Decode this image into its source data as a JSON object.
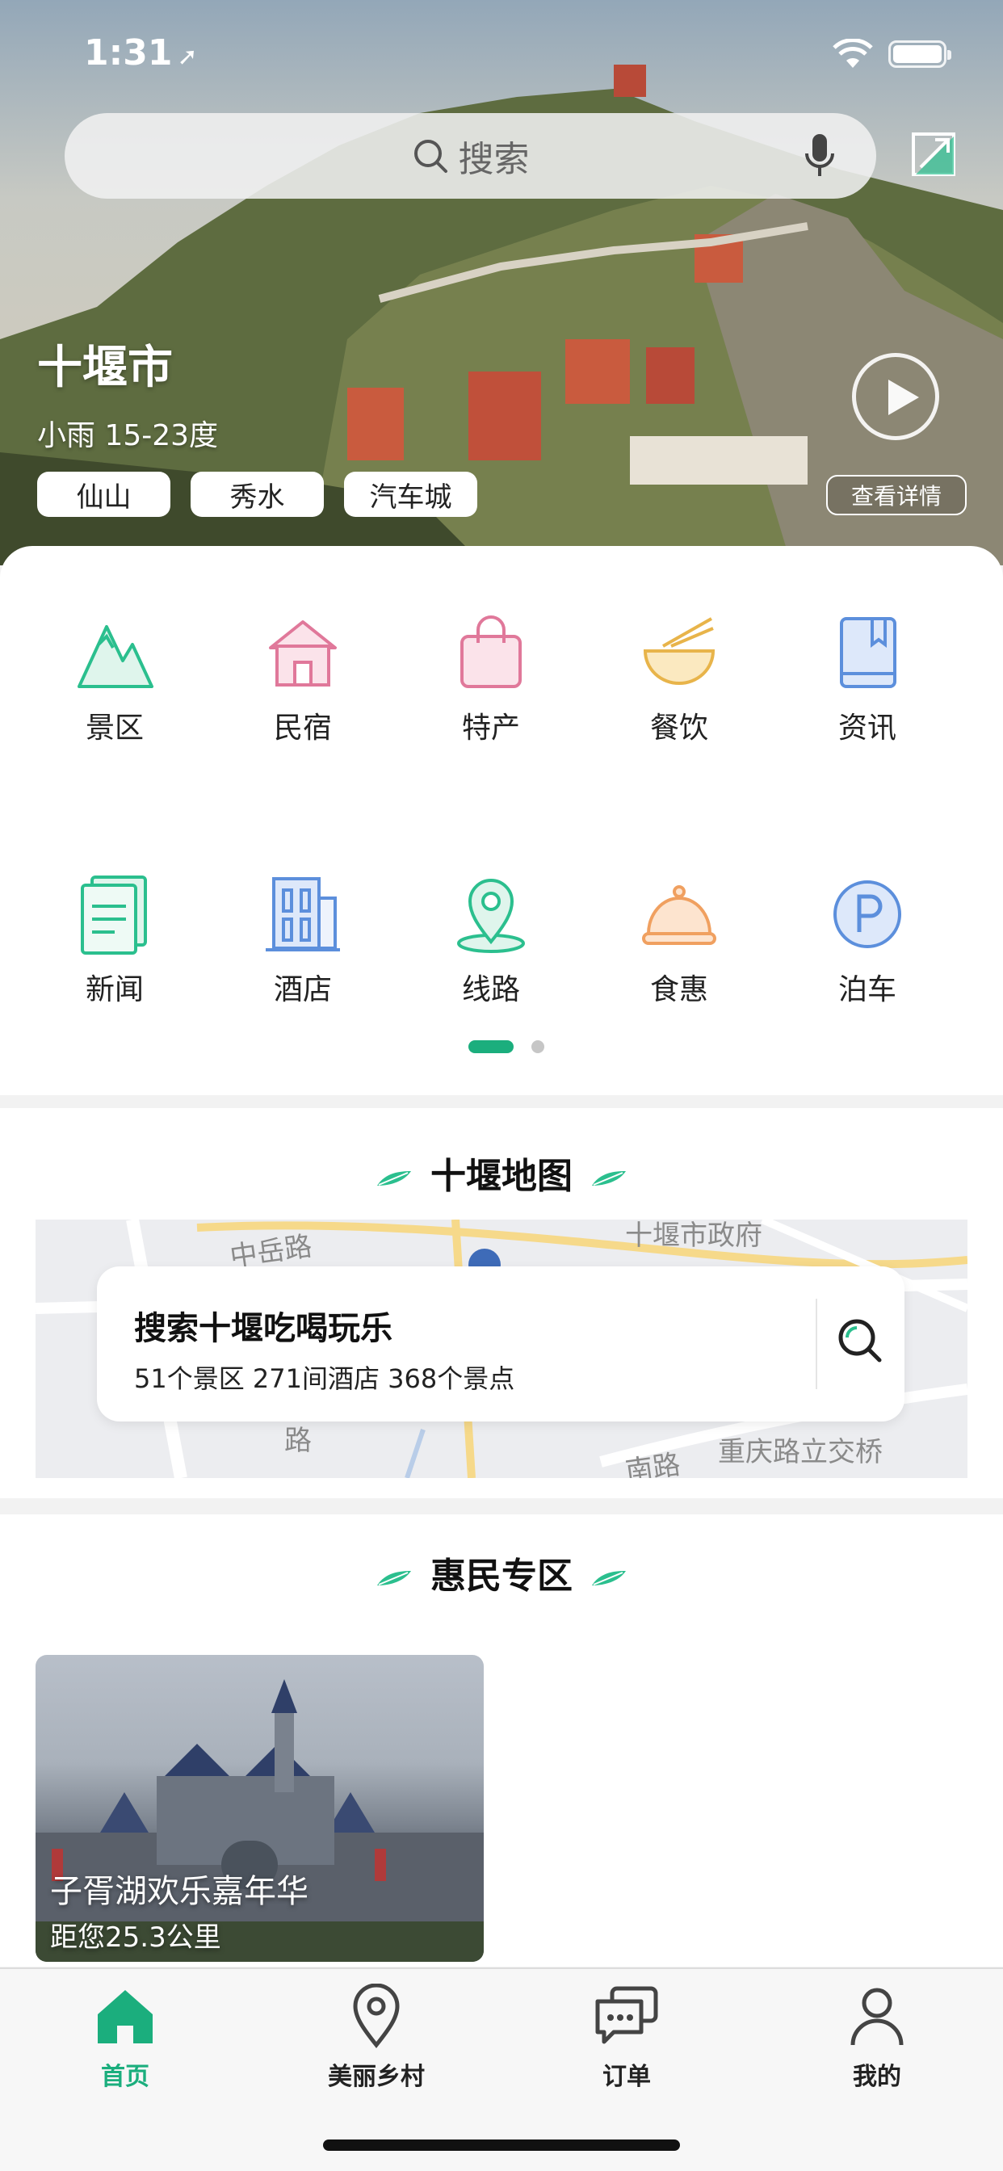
{
  "status_bar": {
    "time": "1:31"
  },
  "search": {
    "placeholder": "搜索"
  },
  "hero": {
    "city": "十堰市",
    "weather": "小雨 15-23度",
    "tags": [
      "仙山",
      "秀水",
      "汽车城"
    ],
    "detail_label": "查看详情"
  },
  "categories": [
    {
      "label": "景区",
      "icon": "mountain-icon",
      "color": "#2bbf8e"
    },
    {
      "label": "民宿",
      "icon": "house-icon",
      "color": "#e0789a"
    },
    {
      "label": "特产",
      "icon": "shopping-bag-icon",
      "color": "#e0789a"
    },
    {
      "label": "餐饮",
      "icon": "noodle-bowl-icon",
      "color": "#e8b44a"
    },
    {
      "label": "资讯",
      "icon": "book-icon",
      "color": "#5c8fdc"
    },
    {
      "label": "新闻",
      "icon": "clipboard-icon",
      "color": "#2bbf8e"
    },
    {
      "label": "酒店",
      "icon": "hotel-building-icon",
      "color": "#5c8fdc"
    },
    {
      "label": "线路",
      "icon": "location-pin-icon",
      "color": "#2bbf8e"
    },
    {
      "label": "食惠",
      "icon": "food-cloche-icon",
      "color": "#f0a060"
    },
    {
      "label": "泊车",
      "icon": "parking-icon",
      "color": "#5c8fdc"
    }
  ],
  "pager": {
    "active_page": 1,
    "total_pages": 2
  },
  "map_section": {
    "title": "十堰地图",
    "card_title": "搜索十堰吃喝玩乐",
    "card_stats": "51个景区 271间酒店 368个景点",
    "labels": [
      "中岳路",
      "十堰市政府",
      "重庆路立交桥",
      "南路",
      "路"
    ]
  },
  "promo_section": {
    "title": "惠民专区",
    "items": [
      {
        "name": "子胥湖欢乐嘉年华",
        "distance": "距您25.3公里"
      }
    ]
  },
  "tab_bar": {
    "items": [
      {
        "label": "首页",
        "icon": "home-icon",
        "active": true
      },
      {
        "label": "美丽乡村",
        "icon": "location-pin-icon",
        "active": false
      },
      {
        "label": "订单",
        "icon": "chat-bubbles-icon",
        "active": false
      },
      {
        "label": "我的",
        "icon": "user-icon",
        "active": false
      }
    ]
  },
  "colors": {
    "accent": "#1bae7d"
  }
}
